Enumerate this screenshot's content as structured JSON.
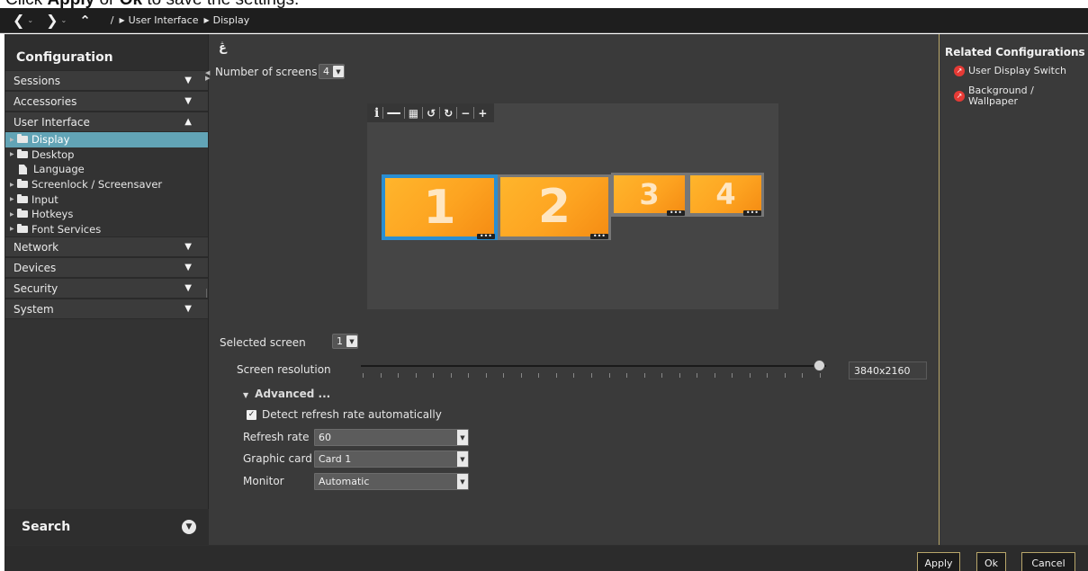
{
  "instruction": {
    "prefix": "Click ",
    "apply": "Apply",
    "middle": " or ",
    "ok": "Ok",
    "suffix": " to save the settings."
  },
  "topbar": {
    "back_icon": "<",
    "forward_icon": ">",
    "up_icon": "^",
    "dropdown_icon": "v",
    "root_sep": "/",
    "crumbs": [
      "User Interface",
      "Display"
    ]
  },
  "sidebar": {
    "title": "Configuration",
    "sections_top": [
      {
        "label": "Sessions",
        "state": "collapsed"
      },
      {
        "label": "Accessories",
        "state": "collapsed"
      },
      {
        "label": "User Interface",
        "state": "expanded"
      }
    ],
    "tree": [
      {
        "label": "Display",
        "icon": "folder-icon",
        "selected": true
      },
      {
        "label": "Desktop",
        "icon": "folder-icon"
      },
      {
        "label": "Language",
        "icon": "file-icon"
      },
      {
        "label": "Screenlock / Screensaver",
        "icon": "folder-icon"
      },
      {
        "label": "Input",
        "icon": "folder-icon"
      },
      {
        "label": "Hotkeys",
        "icon": "folder-icon"
      },
      {
        "label": "Font Services",
        "icon": "folder-icon"
      }
    ],
    "sections_bottom": [
      {
        "label": "Network",
        "state": "collapsed"
      },
      {
        "label": "Devices",
        "state": "collapsed"
      },
      {
        "label": "Security",
        "state": "collapsed"
      },
      {
        "label": "System",
        "state": "collapsed"
      }
    ],
    "search_label": "Search"
  },
  "main": {
    "number_of_screens_label": "Number of screens",
    "number_of_screens_value": "4",
    "arrange_toolbar": [
      "info-icon",
      "horizontal-layout-icon",
      "grid-layout-icon",
      "rotate-left-icon",
      "rotate-right-icon",
      "zoom-out-icon",
      "zoom-in-icon"
    ],
    "screens": [
      {
        "number": "1",
        "selected": true
      },
      {
        "number": "2",
        "selected": false
      },
      {
        "number": "3",
        "selected": false
      },
      {
        "number": "4",
        "selected": false
      }
    ],
    "selected_screen_label": "Selected screen",
    "selected_screen_value": "1",
    "screen_resolution_label": "Screen resolution",
    "screen_resolution_value": "3840x2160",
    "resolution_slider_fraction": 1.0,
    "advanced_label": "Advanced ...",
    "detect_refresh_label": "Detect refresh rate automatically",
    "detect_refresh_checked": true,
    "refresh_rate_label": "Refresh rate",
    "refresh_rate_value": "60",
    "graphic_card_label": "Graphic card",
    "graphic_card_value": "Card 1",
    "monitor_label": "Monitor",
    "monitor_value": "Automatic"
  },
  "related": {
    "title": "Related Configurations",
    "links": [
      "User Display Switch",
      "Background / Wallpaper"
    ]
  },
  "buttons": {
    "apply": "Apply",
    "ok": "Ok",
    "cancel": "Cancel"
  },
  "colors": {
    "accent_selected": "#62a4b6",
    "screen_orange": "#fda421",
    "screen_selected_border": "#2a8ed2",
    "button_border": "#b8a66a",
    "link_icon": "#e63a35"
  }
}
